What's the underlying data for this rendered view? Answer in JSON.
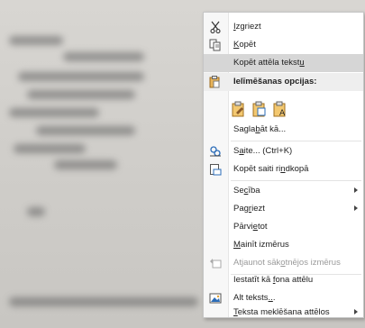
{
  "menu": {
    "cut": {
      "before": "",
      "key": "I",
      "after": "zgriezt"
    },
    "copy": {
      "before": "",
      "key": "K",
      "after": "opēt"
    },
    "copy_text": {
      "before": "Kopēt attēla tekst",
      "key": "u",
      "after": ""
    },
    "paste_header": "Ielīmēšanas opcijas:",
    "paste_options": [
      "paste-keep-formatting-icon",
      "paste-picture-icon",
      "paste-text-only-icon"
    ],
    "save_as": {
      "before": "Sagla",
      "key": "b",
      "after": "āt kā..."
    },
    "link": {
      "before": "S",
      "key": "a",
      "after": "ite...  (Ctrl+K)"
    },
    "copy_link": {
      "before": "Kopēt saiti ri",
      "key": "n",
      "after": "dkopā"
    },
    "order": {
      "before": "Se",
      "key": "c",
      "after": "ība"
    },
    "rotate": {
      "before": "Pag",
      "key": "r",
      "after": "iezt"
    },
    "move": {
      "before": "Pārvi",
      "key": "e",
      "after": "tot"
    },
    "resize": {
      "before": "",
      "key": "M",
      "after": "ainīt izmērus"
    },
    "reset_size": {
      "before": "Atjaunot sāk",
      "key": "o",
      "after": "tnējos izmērus"
    },
    "set_background": {
      "before": "Iestatīt kā ",
      "key": "f",
      "after": "ona attēlu"
    },
    "alt_text": {
      "before": "Alt teksts",
      "key": "..",
      "after": "."
    },
    "text_search": {
      "before": "",
      "key": "T",
      "after": "eksta meklēšana attēlos"
    }
  },
  "colors": {
    "highlight": "#d6d6d6",
    "disabled": "#9a9a9a",
    "icon_blue": "#2b6cb8",
    "icon_orange": "#e0a030"
  }
}
